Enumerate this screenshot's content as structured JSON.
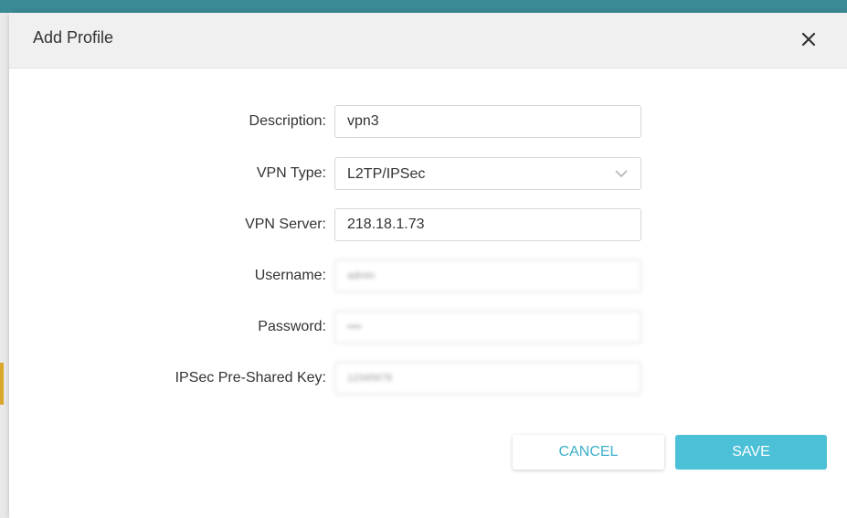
{
  "dialog": {
    "title": "Add Profile",
    "close_glyph": "×",
    "close_icon": "close-icon"
  },
  "form": {
    "description": {
      "label": "Description:",
      "value": "vpn3"
    },
    "vpn_type": {
      "label": "VPN Type:",
      "value": "L2TP/IPSec",
      "icon": "chevron-down-icon"
    },
    "vpn_server": {
      "label": "VPN Server:",
      "value": "218.18.1.73"
    },
    "username": {
      "label": "Username:",
      "value": "admin"
    },
    "password": {
      "label": "Password:",
      "value": "••••"
    },
    "psk": {
      "label": "IPSec Pre-Shared Key:",
      "value": "12345678"
    }
  },
  "actions": {
    "cancel_label": "CANCEL",
    "save_label": "SAVE"
  },
  "colors": {
    "accent": "#4cc0d6",
    "header_bg": "#f0f0f0",
    "cancel_text": "#3bb0c9"
  }
}
